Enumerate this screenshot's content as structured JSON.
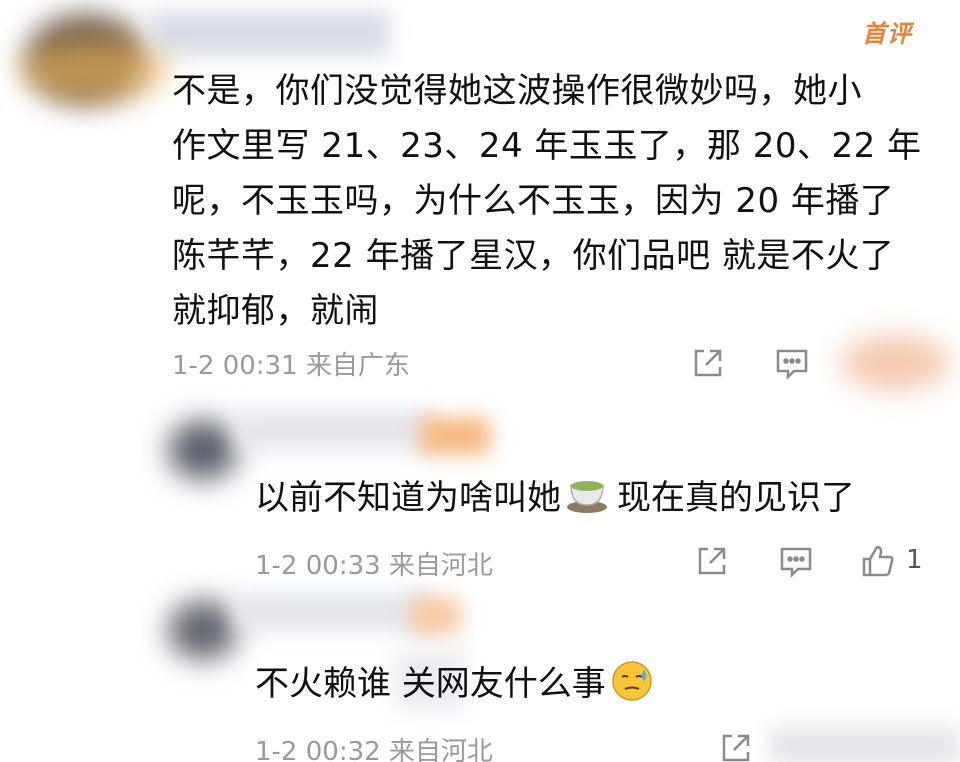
{
  "badge": "首评",
  "main_comment": {
    "lines": [
      "不是，你们没觉得她这波操作很微妙吗，她小",
      "作文里写 21、23、24 年玉玉了，那 20、22 年",
      "呢，不玉玉吗，为什么不玉玉，因为 20 年播了",
      "陈芊芊，22 年播了星汉，你们品吧 就是不火了",
      "就抑郁，就闹"
    ],
    "meta": "1-2 00:31 来自广东"
  },
  "replies": [
    {
      "text_before": "以前不知道为啥叫她",
      "text_after": "现在真的见识了",
      "emoji_icon": "green-tea-icon",
      "meta": "1-2 00:33 来自河北",
      "likes": "1"
    },
    {
      "text_before": "不火赖谁 关网友什么事",
      "text_after": "",
      "emoji_icon": "sweat-face-icon",
      "meta": "1-2 00:32 来自河北",
      "likes": ""
    }
  ],
  "colors": {
    "badge": "#e8823a",
    "meta": "#9a9a9a",
    "text": "#111111",
    "icon": "#8a8a8a"
  }
}
